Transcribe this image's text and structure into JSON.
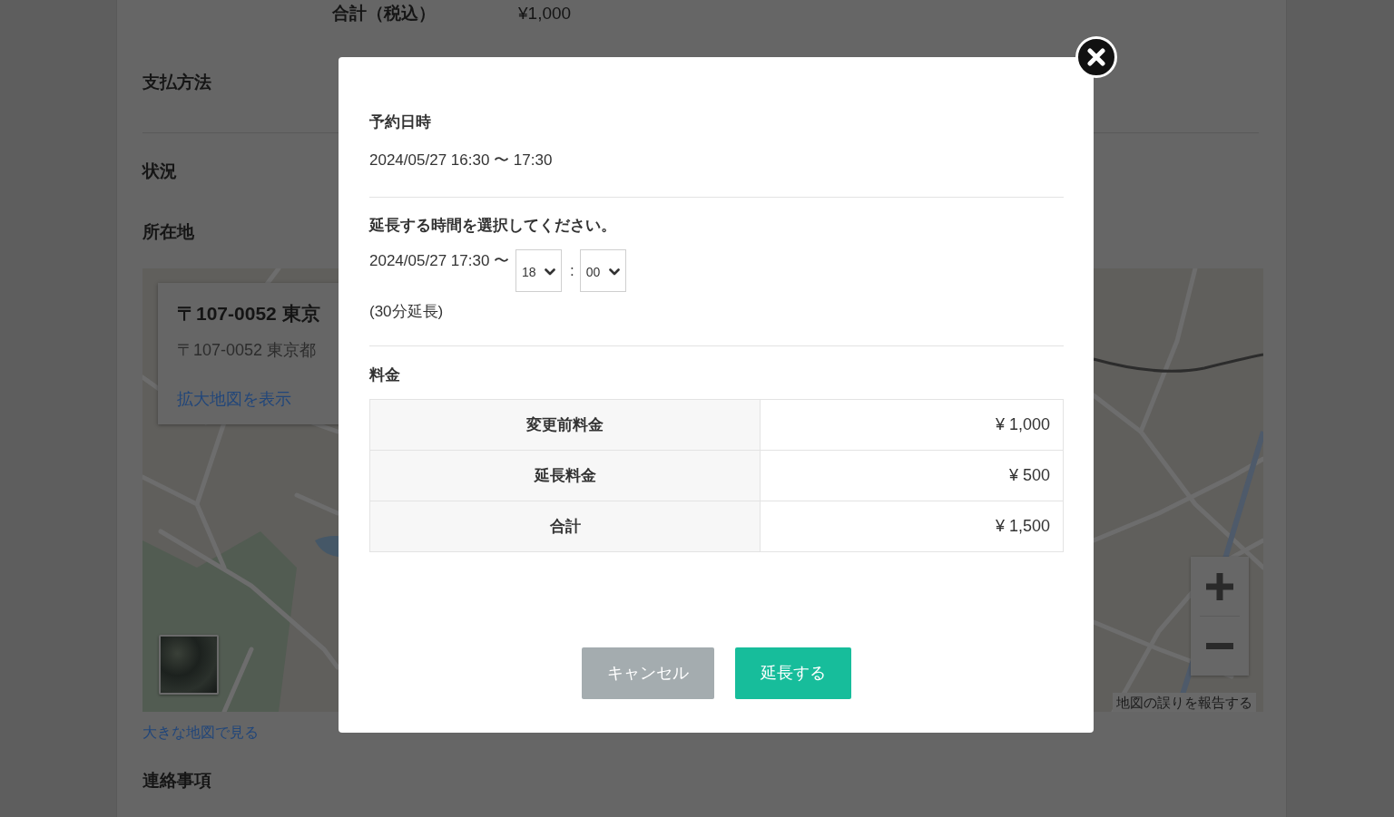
{
  "page": {
    "total": {
      "label": "合計（税込）",
      "value": "¥1,000"
    },
    "field_sections": [
      {
        "fields": [
          {
            "label": "支払方法"
          }
        ]
      },
      {
        "fields": [
          {
            "label": "状況"
          },
          {
            "label": "所在地"
          }
        ]
      }
    ],
    "map": {
      "info_card": {
        "title": "〒107-0052 東京",
        "address": "〒107-0052 東京都",
        "link": "拡大地図を表示"
      },
      "report_link": "地図の誤りを報告する"
    },
    "map_link": "大きな地図で見る",
    "next_heading": "連絡事項"
  },
  "modal": {
    "reservation": {
      "heading": "予約日時",
      "datetime": "2024/05/27 16:30 〜 17:30"
    },
    "extension": {
      "heading": "延長する時間を選択してください。",
      "start": "2024/05/27 17:30 〜",
      "hour_select": {
        "value": "18"
      },
      "separator": ":",
      "minute_select": {
        "value": "00"
      },
      "note": "(30分延長)"
    },
    "fee": {
      "heading": "料金",
      "rows": [
        {
          "label": "変更前料金",
          "amount": "¥ 1,000"
        },
        {
          "label": "延長料金",
          "amount": "¥ 500"
        },
        {
          "label": "合計",
          "amount": "¥ 1,500"
        }
      ]
    },
    "buttons": [
      {
        "label": "キャンセル",
        "kind": "secondary"
      },
      {
        "label": "延長する",
        "kind": "primary"
      }
    ]
  }
}
